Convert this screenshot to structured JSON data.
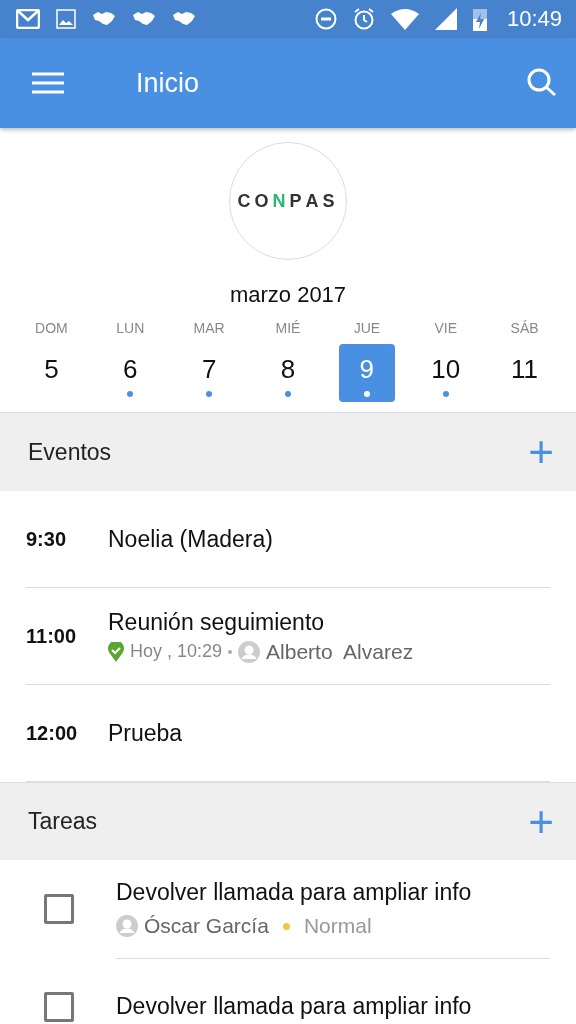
{
  "status_bar": {
    "time": "10:49"
  },
  "app_bar": {
    "title": "Inicio"
  },
  "logo": {
    "text": "CONPAS"
  },
  "calendar": {
    "month": "marzo 2017",
    "days": [
      {
        "weekday": "DOM",
        "day": "5",
        "selected": false,
        "has_events": false
      },
      {
        "weekday": "LUN",
        "day": "6",
        "selected": false,
        "has_events": true
      },
      {
        "weekday": "MAR",
        "day": "7",
        "selected": false,
        "has_events": true
      },
      {
        "weekday": "MIÉ",
        "day": "8",
        "selected": false,
        "has_events": true
      },
      {
        "weekday": "JUE",
        "day": "9",
        "selected": true,
        "has_events": true
      },
      {
        "weekday": "VIE",
        "day": "10",
        "selected": false,
        "has_events": true
      },
      {
        "weekday": "SÁB",
        "day": "11",
        "selected": false,
        "has_events": false
      }
    ]
  },
  "events": {
    "title": "Eventos",
    "add": "+",
    "items": [
      {
        "time": "9:30",
        "title": "Noelia (Madera)"
      },
      {
        "time": "11:00",
        "title": "Reunión seguimiento",
        "checkin": "Hoy , 10:29",
        "person": "Alberto  Alvarez"
      },
      {
        "time": "12:00",
        "title": "Prueba"
      }
    ]
  },
  "tasks": {
    "title": "Tareas",
    "add": "+",
    "items": [
      {
        "title": "Devolver llamada para ampliar info",
        "checked": false,
        "person": "Óscar García",
        "priority": "Normal",
        "color": "#f6c342"
      },
      {
        "title": "Devolver llamada para ampliar info",
        "checked": false
      }
    ]
  }
}
